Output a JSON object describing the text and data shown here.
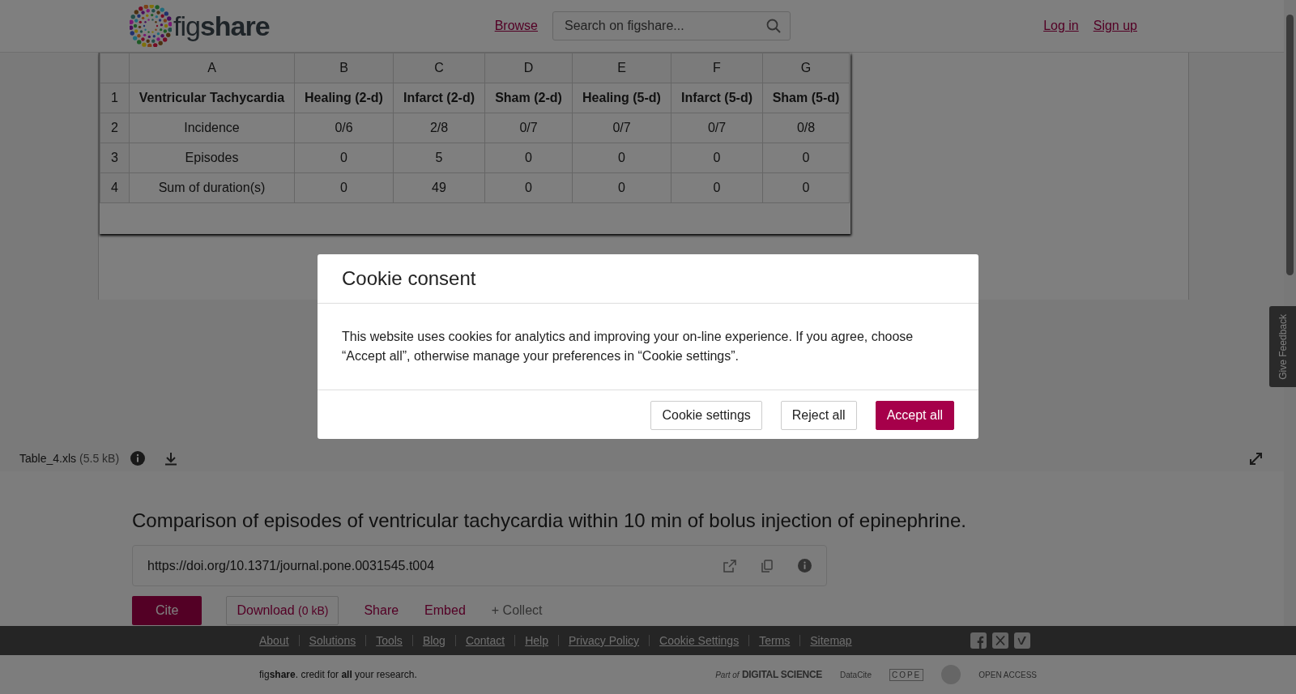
{
  "header": {
    "logo": "fig**share**",
    "nav_link": "Browse",
    "search": {
      "placeholder": "Search on figshare..."
    },
    "auth_links": [
      "Log in",
      "Sign up"
    ]
  },
  "preview": {
    "columns": [
      "A",
      "B",
      "C",
      "D",
      "E",
      "F",
      "G"
    ],
    "rows": [
      {
        "number": "1",
        "header": true,
        "cells": [
          "Ventricular Tachycardia",
          "Healing (2-d)",
          "Infarct (2-d)",
          "Sham (2-d)",
          "Healing (5-d)",
          "Infarct (5-d)",
          "Sham (5-d)"
        ]
      },
      {
        "number": "2",
        "header": false,
        "cells": [
          "Incidence",
          "0/6",
          "2/8",
          "0/7",
          "0/7",
          "0/7",
          "0/8"
        ]
      },
      {
        "number": "3",
        "header": false,
        "cells": [
          "Episodes",
          "0",
          "5",
          "0",
          "0",
          "0",
          "0"
        ]
      },
      {
        "number": "4",
        "header": false,
        "cells": [
          "Sum of duration(s)",
          "0",
          "49",
          "0",
          "0",
          "0",
          "0"
        ]
      }
    ],
    "file": {
      "name": "Table_4.xls",
      "size": "(5.5 kB)"
    }
  },
  "item": {
    "title": "Comparison of episodes of ventricular tachycardia within 10 min of bolus injection of epinephrine.",
    "doi": "https://doi.org/10.1371/journal.pone.0031545.t004",
    "actions": [
      {
        "kind": "primary",
        "label": "Cite"
      },
      {
        "kind": "outline",
        "label": "Download",
        "note": "(0 kB)"
      },
      {
        "kind": "link",
        "label": "Share"
      },
      {
        "kind": "link",
        "label": "Embed"
      },
      {
        "kind": "muted",
        "label": "+ Collect"
      }
    ]
  },
  "feedback_tab": "Give Feedback",
  "footer": {
    "links": [
      "About",
      "Solutions",
      "Tools",
      "Blog",
      "Contact",
      "Help",
      "Privacy Policy",
      "Cookie Settings",
      "Terms",
      "Sitemap"
    ],
    "tagline": "fig**share**. credit for **all** your research.",
    "partners": [
      {
        "kind": "digital",
        "prefix": "Part of",
        "text": "DIGITAL SCIENCE"
      },
      {
        "kind": "datacite",
        "text": "DataCite"
      },
      {
        "kind": "spaced",
        "text": "COPE"
      },
      {
        "kind": "seal"
      },
      {
        "kind": "access",
        "text": "OPEN ACCESS"
      }
    ]
  },
  "cookie_dialog": {
    "title": "Cookie consent",
    "body": "This website uses cookies for analytics and improving your on-line experience. If you agree, choose “Accept all”, otherwise manage your preferences in “Cookie settings”.",
    "buttons": [
      {
        "kind": "secondary",
        "label": "Cookie settings"
      },
      {
        "kind": "secondary",
        "label": "Reject all"
      },
      {
        "kind": "primary",
        "label": "Accept all"
      }
    ]
  }
}
